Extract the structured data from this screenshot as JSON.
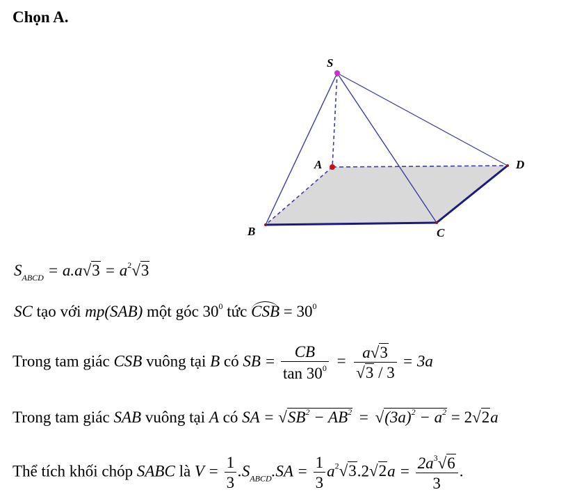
{
  "heading": "Chọn A.",
  "figure": {
    "labels": {
      "S": "S",
      "A": "A",
      "B": "B",
      "C": "C",
      "D": "D"
    },
    "colors": {
      "edge": "#3c3ca0",
      "base_fill": "#d9d9d9",
      "apex_point": "#cc33cc",
      "point": "#cc1111"
    }
  },
  "line1": {
    "S": "S",
    "sub": "ABCD",
    "eq1": "= a.a",
    "r3": "3",
    "eq2": "= a",
    "sup2": "2",
    "r3b": "3"
  },
  "line2": {
    "sc": "SC",
    "t1": "tạo với",
    "mp": "mp",
    "plane": "(SAB)",
    "t2": "một góc",
    "angle": "30",
    "deg": "0",
    "t3": "tức",
    "csb": "CSB",
    "eq": "= 30",
    "deg2": "0"
  },
  "line3": {
    "t1": "Trong tam giác",
    "tri": "CSB",
    "t2": "vuông tại",
    "v": "B",
    "t3": "có",
    "lhs": "SB =",
    "num1": "CB",
    "den1": "tan 30",
    "deg": "0",
    "num2a": "a",
    "num2r": "3",
    "den2r": "3",
    "den2b": "/ 3",
    "res": "= 3a"
  },
  "line4": {
    "t1": "Trong tam giác",
    "tri": "SAB",
    "t2": "vuông tại",
    "v": "A",
    "t3": "có",
    "lhs": "SA =",
    "r1a": "SB",
    "sq": "2",
    "minus": "− AB",
    "sq2": "2",
    "r2a": "(3a)",
    "sq3": "2",
    "r2b": "− a",
    "sq4": "2",
    "res1": "= 2",
    "res_r": "2",
    "res2": "a"
  },
  "line5": {
    "t1": "Thể tích khối chóp",
    "solid": "SABC",
    "t2": "là",
    "lhs": "V =",
    "n1": "1",
    "d1": "3",
    "s": ".S",
    "sub": "ABCD",
    "sa": ".SA =",
    "n2": "1",
    "d2": "3",
    "a2": "a",
    "sup": "2",
    "r3": "3",
    "mid": ".2",
    "r2": "2",
    "a": "a =",
    "n3a": "2a",
    "n3sup": "3",
    "n3r": "6",
    "d3": "3",
    "end": "."
  }
}
